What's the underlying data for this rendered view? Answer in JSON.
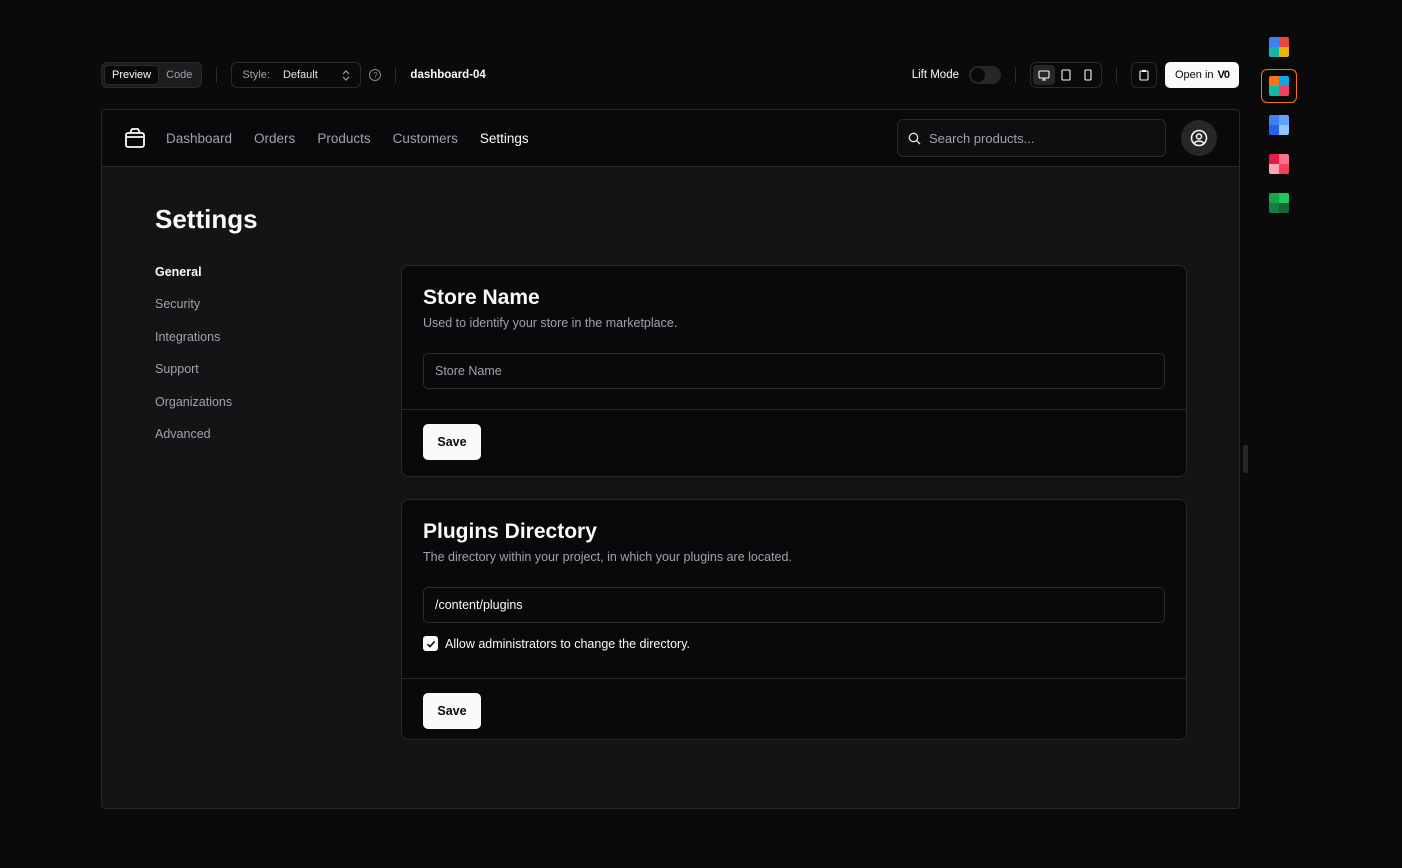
{
  "toolbar": {
    "tabs": [
      {
        "label": "Preview",
        "active": true
      },
      {
        "label": "Code",
        "active": false
      }
    ],
    "style_label": "Style:",
    "style_value": "Default",
    "block_name": "dashboard-04",
    "lift_mode_label": "Lift Mode",
    "open_in_label": "Open in",
    "open_in_brand": "V0"
  },
  "nav": {
    "links": [
      "Dashboard",
      "Orders",
      "Products",
      "Customers",
      "Settings"
    ],
    "active": "Settings",
    "search_placeholder": "Search products..."
  },
  "page": {
    "title": "Settings",
    "sidebar": [
      "General",
      "Security",
      "Integrations",
      "Support",
      "Organizations",
      "Advanced"
    ],
    "sidebar_active": "General"
  },
  "cards": {
    "store": {
      "title": "Store Name",
      "description": "Used to identify your store in the marketplace.",
      "placeholder": "Store Name",
      "save": "Save"
    },
    "plugins": {
      "title": "Plugins Directory",
      "description": "The directory within your project, in which your plugins are located.",
      "value": "/content/plugins",
      "checkbox_label": "Allow administrators to change the directory.",
      "checked": true,
      "save": "Save"
    }
  },
  "themes": [
    {
      "name": "theme-multicolor",
      "colors": [
        "#3b82f6",
        "#ef4444",
        "#14b8a6",
        "#eab308"
      ]
    },
    {
      "name": "theme-orange-teal",
      "colors": [
        "#f97316",
        "#0ea5e9",
        "#14b8a6",
        "#f43f5e"
      ],
      "active": true
    },
    {
      "name": "theme-blue",
      "colors": [
        "#3b82f6",
        "#60a5fa",
        "#2563eb",
        "#93c5fd"
      ]
    },
    {
      "name": "theme-rose",
      "colors": [
        "#e11d48",
        "#fb7185",
        "#fda4af",
        "#f43f5e"
      ]
    },
    {
      "name": "theme-green",
      "colors": [
        "#16a34a",
        "#22c55e",
        "#15803d",
        "#166534"
      ]
    }
  ]
}
